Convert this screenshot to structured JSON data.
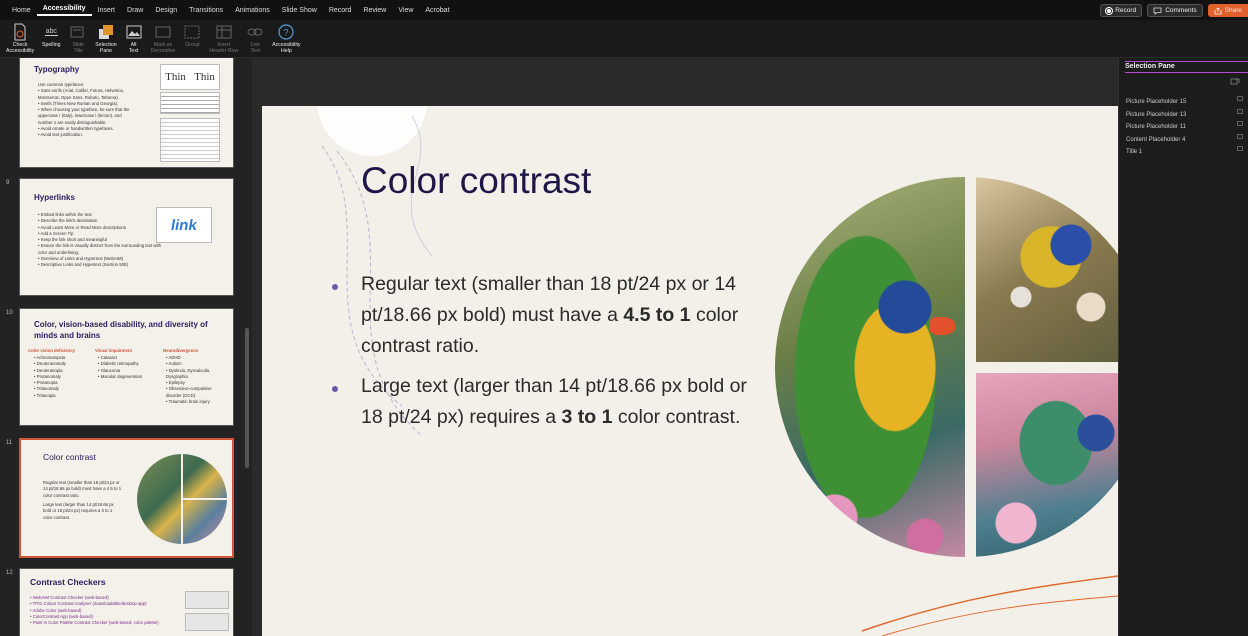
{
  "menu": {
    "tabs": [
      "Home",
      "Accessibility",
      "Insert",
      "Draw",
      "Design",
      "Transitions",
      "Animations",
      "Slide Show",
      "Record",
      "Review",
      "View",
      "Acrobat"
    ],
    "active_tab": "Accessibility",
    "record_label": "Record",
    "comments_label": "Comments",
    "share_label": "Share"
  },
  "ribbon": {
    "check_accessibility": "Check\nAccessibility",
    "spelling": "Spelling",
    "slide_title": "Slide\nTitle",
    "selection_pane": "Selection\nPane",
    "alt_text": "Alt\nText",
    "mark_decorative": "Mark as\nDecorative",
    "group": "Group",
    "insert_header_row": "Insert\nHeader Row",
    "link_text": "Link\nText",
    "accessibility_help": "Accessibility\nHelp",
    "spelling_icon_text": "abc"
  },
  "thumbnails": {
    "slide8": {
      "title": "Typography",
      "body": "Use common typefaces:\n   •  Sans serifs (Arial, Calibri, Futura, Helvetica,\n       Montserrat, Open Sans, Roboto, Tahoma)\n   •  Serifs (Times New Roman and Georgia).\n•  When choosing your typeface, be sure that the\n   uppercase I (Italy), lowercase l (lemon), and\n   number 1 are easily distinguishable.\n•  Avoid ornate or handwritten typefaces.\n•  Avoid text justification.",
      "thin_label": "Thin",
      "thin_label2": "Thin"
    },
    "slide9": {
      "number": "9",
      "title": "Hyperlinks",
      "body": "•  Embed links within the text\n•  Describe the link's destination\n      •  Avoid Learn More or Read More descriptions\n      •  Add a Screen Tip\n•  Keep the link short and meaningful\n•  Ensure the link is visually distinct from the surrounding text with\n   color and underlining.\n•  Overview of Links and Hypertext (WebAIM)\n•  Descriptive Links and Hypertext (Section 508)",
      "link_img_text": "link"
    },
    "slide10": {
      "number": "10",
      "title": "Color, vision-based disability, and diversity of\nminds and brains",
      "col1_head": "Color vision deficiency",
      "col1": "•  Achromatopsia\n•  Deuteranomaly\n•  Deuteranopia\n•  Protanomaly\n•  Protanopia\n•  Tritanomaly\n•  Tritanopia",
      "col2_head": "Visual impairment",
      "col2": "•  Cataract\n•  Diabetic retinopathy\n•  Glaucoma\n•  Macular degeneration",
      "col3_head": "Neurodivergence",
      "col3": "•  ADHD\n•  Autism\n•  Dyslexia, Dyscalculia,\n   Dysgraphia\n•  Epilepsy\n•  Obsessive-compulsive\n   disorder (OCD)\n•  Traumatic brain injury"
    },
    "slide11": {
      "number": "11",
      "title": "Color contrast",
      "body1": "Regular text (smaller than 18 pt/24 px or\n14 pt/18.66 px bold) must have a 4.5 to 1\ncolor contrast ratio.",
      "body2": "Large text (larger than 14 pt/18.66 px\nbold or 18 pt/24 px)  requires a 3 to 1\ncolor contrast."
    },
    "slide12": {
      "number": "12",
      "title": "Contrast Checkers",
      "body": "•  WebAIM Contrast Checker (web-based)\n•  TPGi Colour Contrast Analyser (downloadable/desktop app)\n•  Adobe Color (web-based)\n•  ColorContrast App (web-based)\n•  Paint in Color Palette Contrast Checker (web-based, color palette)"
    }
  },
  "main_slide": {
    "title": "Color contrast",
    "bullet1_a": "Regular text (smaller than 18 pt/24 px or 14 pt/18.66 px bold) must have a ",
    "bullet1_b": "4.5 to 1",
    "bullet1_c": " color contrast ratio.",
    "bullet2_a": "Large text (larger than 14 pt/18.66 px bold or 18 pt/24 px)  requires a ",
    "bullet2_b": "3 to 1",
    "bullet2_c": " color contrast."
  },
  "selection_pane": {
    "title": "Selection Pane",
    "items": [
      "Picture Placeholder 15",
      "Picture Placeholder 13",
      "Picture Placeholder 11",
      "Content Placeholder 4",
      "Title 1"
    ]
  },
  "colors": {
    "accent": "#d0553a",
    "title": "#1f1748",
    "share": "#e1602b",
    "pane_highlight": "#b74bd6"
  }
}
